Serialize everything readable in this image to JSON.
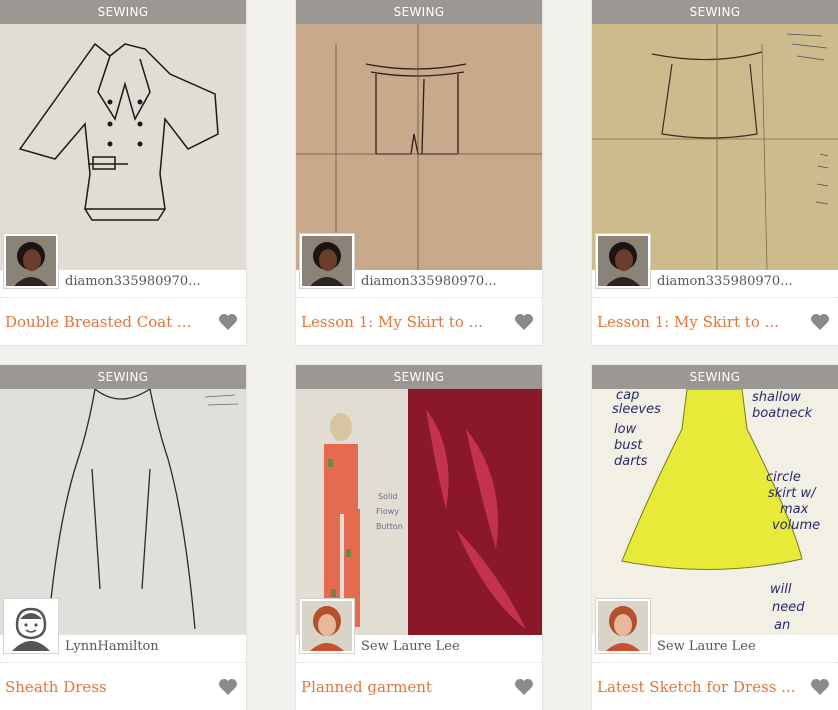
{
  "cards": [
    {
      "category": "SEWING",
      "user": "diamon335980970...",
      "title": "Double Breasted Coat ...",
      "avatar": "user-photo-avatar",
      "image": "coat-sketch"
    },
    {
      "category": "SEWING",
      "user": "diamon335980970...",
      "title": "Lesson 1: My Skirt to ...",
      "avatar": "user-photo-avatar",
      "image": "skirt-sketch"
    },
    {
      "category": "SEWING",
      "user": "diamon335980970...",
      "title": "Lesson 1: My Skirt to ...",
      "avatar": "user-photo-avatar",
      "image": "skirt-sketch-notes"
    },
    {
      "category": "SEWING",
      "user": "LynnHamilton",
      "title": "Sheath Dress",
      "avatar": "default-avatar",
      "image": "sheath-dress-sketch"
    },
    {
      "category": "SEWING",
      "user": "Sew Laure Lee",
      "title": "Planned garment",
      "avatar": "user-photo-avatar",
      "image": "jumpsuit-sketch-fabric"
    },
    {
      "category": "SEWING",
      "user": "Sew Laure Lee",
      "title": "Latest Sketch for Dress ...",
      "avatar": "user-photo-avatar",
      "image": "yellow-dress-sketch"
    }
  ],
  "sketch_notes": {
    "card4": [
      "Solid",
      "Flowy",
      "Button"
    ],
    "card6": [
      "cap",
      "sleeves",
      "low",
      "bust",
      "darts",
      "shallow",
      "boatneck",
      "circle",
      "skirt w/",
      "max",
      "volume",
      "will",
      "need",
      "an"
    ]
  },
  "colors": {
    "accent": "#e0763a",
    "category_bar": "#9b9793",
    "heart": "#8a8a8a",
    "page_bg": "#f1f0ec"
  }
}
